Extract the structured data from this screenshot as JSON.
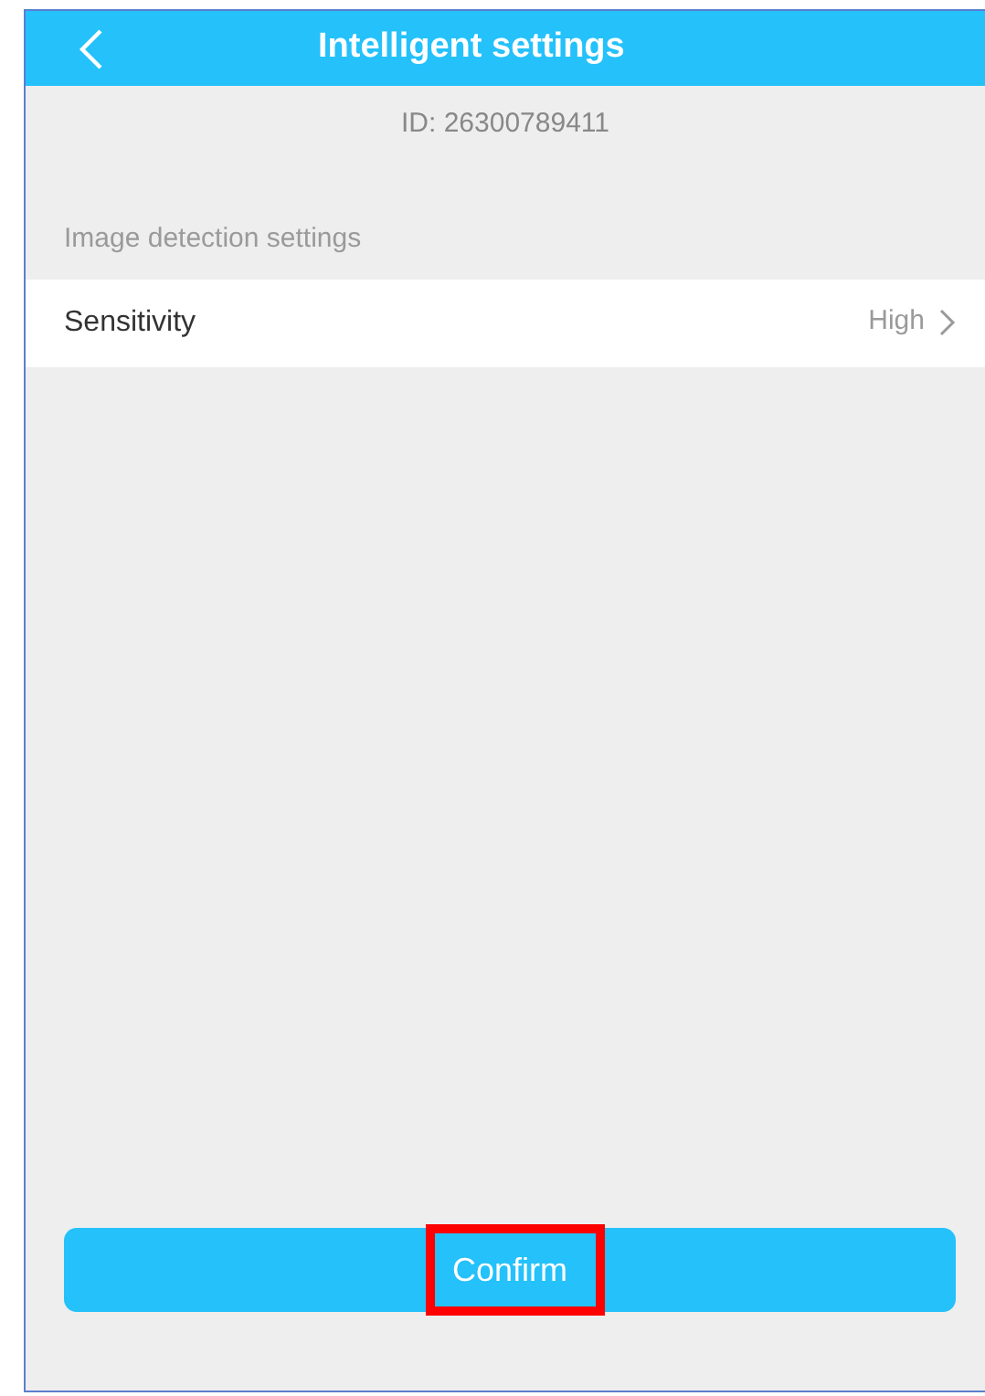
{
  "header": {
    "title": "Intelligent settings"
  },
  "device_id": "ID: 26300789411",
  "section": {
    "label": "Image detection settings"
  },
  "settings": [
    {
      "label": "Sensitivity",
      "value": "High"
    }
  ],
  "confirm_button": {
    "label": "Confirm",
    "highlighted": true
  }
}
